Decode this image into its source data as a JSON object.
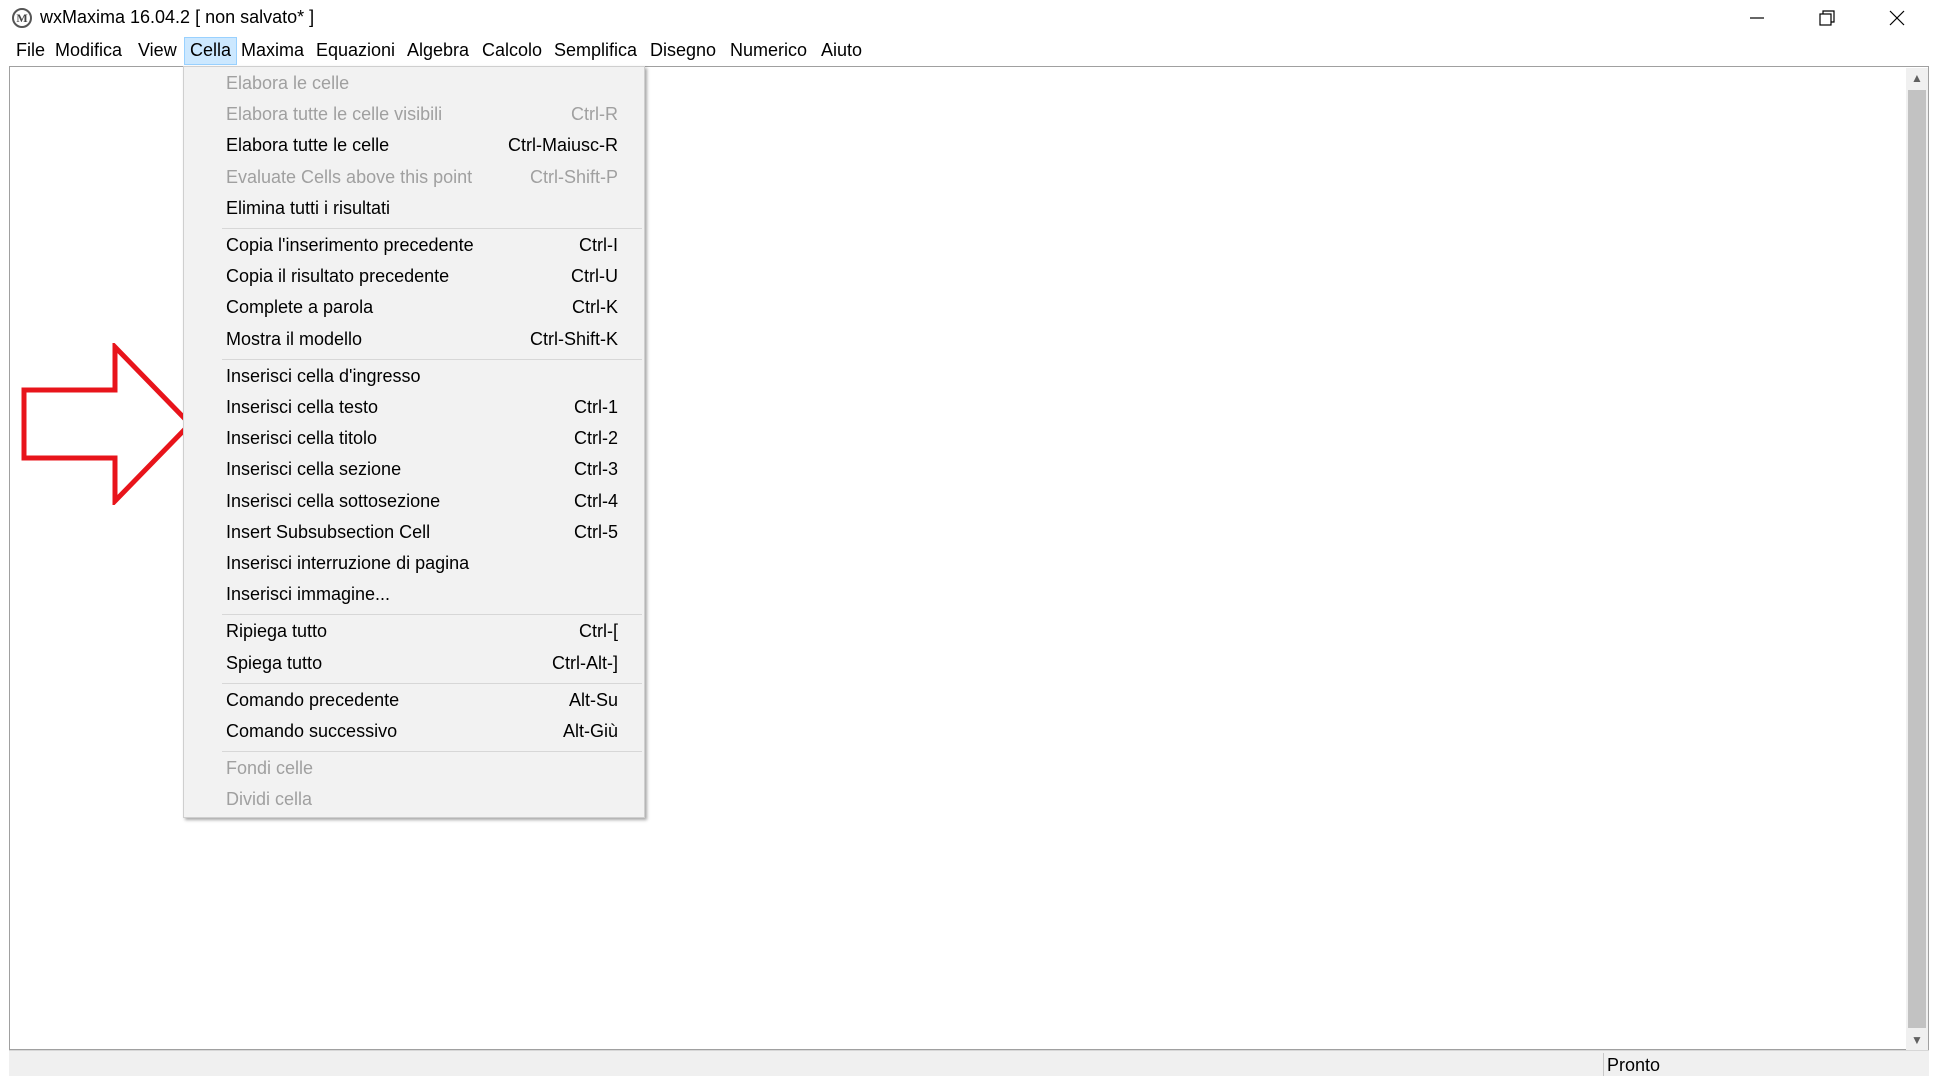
{
  "window": {
    "title": "wxMaxima 16.04.2 [ non salvato* ]",
    "app_icon_glyph": "M"
  },
  "menubar": {
    "items": [
      {
        "label": "File"
      },
      {
        "label": "Modifica"
      },
      {
        "label": "View"
      },
      {
        "label": "Cella",
        "active": true
      },
      {
        "label": "Maxima"
      },
      {
        "label": "Equazioni"
      },
      {
        "label": "Algebra"
      },
      {
        "label": "Calcolo"
      },
      {
        "label": "Semplifica"
      },
      {
        "label": "Disegno"
      },
      {
        "label": "Numerico"
      },
      {
        "label": "Aiuto"
      }
    ]
  },
  "cell_menu": {
    "items": [
      {
        "label": "Elabora le celle",
        "shortcut": "",
        "enabled": false
      },
      {
        "label": "Elabora tutte le celle visibili",
        "shortcut": "Ctrl-R",
        "enabled": false
      },
      {
        "label": "Elabora tutte le celle",
        "shortcut": "Ctrl-Maiusc-R",
        "enabled": true
      },
      {
        "label": "Evaluate Cells above this point",
        "shortcut": "Ctrl-Shift-P",
        "enabled": false
      },
      {
        "label": "Elimina tutti i risultati",
        "shortcut": "",
        "enabled": true
      },
      {
        "label": "Copia l'inserimento precedente",
        "shortcut": "Ctrl-I",
        "enabled": true
      },
      {
        "label": "Copia il risultato precedente",
        "shortcut": "Ctrl-U",
        "enabled": true
      },
      {
        "label": "Complete a parola",
        "shortcut": "Ctrl-K",
        "enabled": true
      },
      {
        "label": "Mostra il modello",
        "shortcut": "Ctrl-Shift-K",
        "enabled": true
      },
      {
        "label": "Inserisci cella d'ingresso",
        "shortcut": "",
        "enabled": true
      },
      {
        "label": "Inserisci cella testo",
        "shortcut": "Ctrl-1",
        "enabled": true
      },
      {
        "label": "Inserisci cella titolo",
        "shortcut": "Ctrl-2",
        "enabled": true
      },
      {
        "label": "Inserisci cella sezione",
        "shortcut": "Ctrl-3",
        "enabled": true
      },
      {
        "label": "Inserisci cella sottosezione",
        "shortcut": "Ctrl-4",
        "enabled": true
      },
      {
        "label": "Insert Subsubsection Cell",
        "shortcut": "Ctrl-5",
        "enabled": true
      },
      {
        "label": "Inserisci interruzione di pagina",
        "shortcut": "",
        "enabled": true
      },
      {
        "label": "Inserisci immagine...",
        "shortcut": "",
        "enabled": true
      },
      {
        "label": "Ripiega tutto",
        "shortcut": "Ctrl-[",
        "enabled": true
      },
      {
        "label": "Spiega tutto",
        "shortcut": "Ctrl-Alt-]",
        "enabled": true
      },
      {
        "label": "Comando precedente",
        "shortcut": "Alt-Su",
        "enabled": true
      },
      {
        "label": "Comando successivo",
        "shortcut": "Alt-Giù",
        "enabled": true
      },
      {
        "label": "Fondi celle",
        "shortcut": "",
        "enabled": false
      },
      {
        "label": "Dividi cella",
        "shortcut": "",
        "enabled": false
      }
    ]
  },
  "statusbar": {
    "text": "Pronto"
  },
  "annotation": {
    "shape": "arrow-right-icon",
    "color": "#e8141b"
  },
  "colors": {
    "menu_active_bg": "#cce8ff",
    "menu_bg": "#f2f2f2",
    "disabled_text": "#a0a0a0",
    "scrollbar_thumb": "#c2c2c2"
  }
}
